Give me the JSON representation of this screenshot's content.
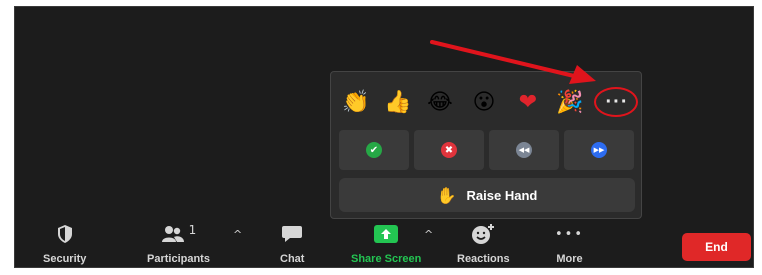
{
  "reactions": {
    "emojis": [
      {
        "name": "clap",
        "glyph": "👏"
      },
      {
        "name": "thumbs-up",
        "glyph": "👍"
      },
      {
        "name": "laugh",
        "glyph": "😂"
      },
      {
        "name": "surprised",
        "glyph": "😮"
      },
      {
        "name": "heart",
        "glyph": "❤"
      },
      {
        "name": "party",
        "glyph": "🎉"
      }
    ],
    "more_label": "···",
    "feedback": [
      {
        "name": "yes",
        "glyph": "✔",
        "color": "#26a846"
      },
      {
        "name": "no",
        "glyph": "✖",
        "color": "#e0343c"
      },
      {
        "name": "slower",
        "glyph": "◀◀",
        "color": "#7b8594"
      },
      {
        "name": "faster",
        "glyph": "▶▶",
        "color": "#2d6cf0"
      }
    ],
    "raise_hand_label": "Raise Hand",
    "raise_hand_glyph": "✋"
  },
  "toolbar": {
    "security": "Security",
    "participants": "Participants",
    "participants_count": "1",
    "chat": "Chat",
    "share_screen": "Share Screen",
    "reactions": "Reactions",
    "more": "More",
    "more_dots": "•••",
    "caret": "^",
    "end": "End"
  },
  "colors": {
    "share_green": "#23c552",
    "end_red": "#e02828",
    "annotation_red": "#e0141c"
  }
}
